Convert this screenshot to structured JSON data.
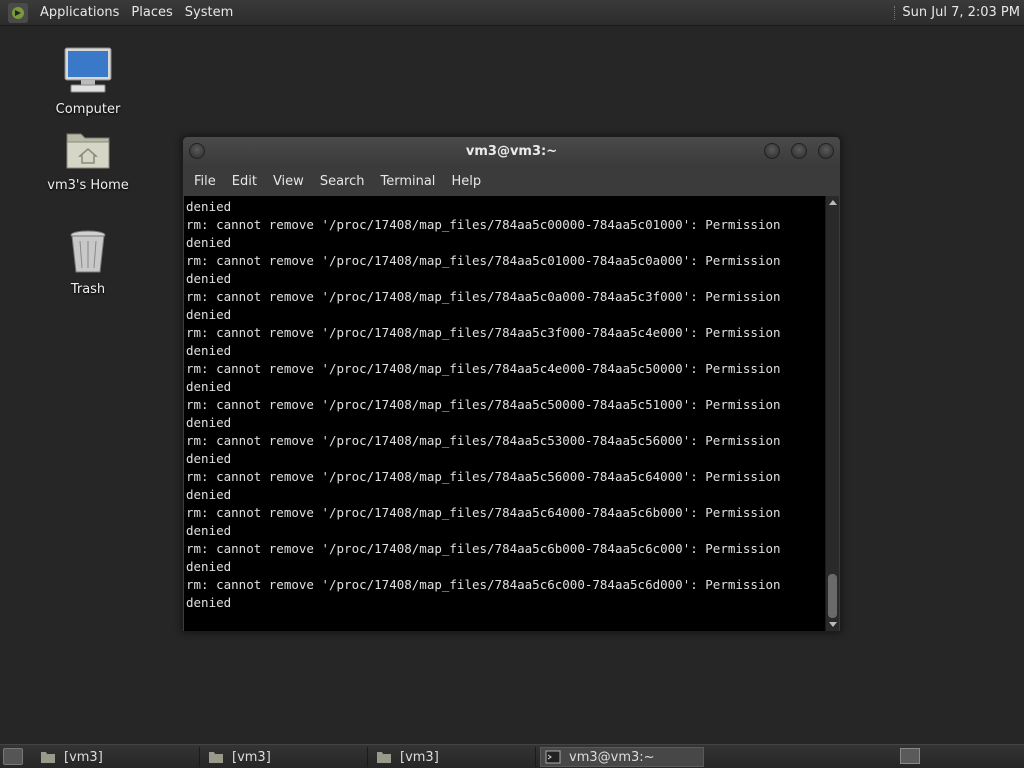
{
  "top_panel": {
    "menus": [
      "Applications",
      "Places",
      "System"
    ],
    "clock": "Sun Jul 7,  2:03 PM"
  },
  "desktop": {
    "icons": [
      {
        "label": "Computer",
        "icon": "computer-icon"
      },
      {
        "label": "vm3's Home",
        "icon": "home-folder-icon"
      },
      {
        "label": "Trash",
        "icon": "trash-icon"
      }
    ]
  },
  "terminal": {
    "title": "vm3@vm3:~",
    "menu": [
      "File",
      "Edit",
      "View",
      "Search",
      "Terminal",
      "Help"
    ],
    "lines": [
      "denied",
      "rm: cannot remove '/proc/17408/map_files/784aa5c00000-784aa5c01000': Permission",
      "denied",
      "rm: cannot remove '/proc/17408/map_files/784aa5c01000-784aa5c0a000': Permission",
      "denied",
      "rm: cannot remove '/proc/17408/map_files/784aa5c0a000-784aa5c3f000': Permission",
      "denied",
      "rm: cannot remove '/proc/17408/map_files/784aa5c3f000-784aa5c4e000': Permission",
      "denied",
      "rm: cannot remove '/proc/17408/map_files/784aa5c4e000-784aa5c50000': Permission",
      "denied",
      "rm: cannot remove '/proc/17408/map_files/784aa5c50000-784aa5c51000': Permission",
      "denied",
      "rm: cannot remove '/proc/17408/map_files/784aa5c53000-784aa5c56000': Permission",
      "denied",
      "rm: cannot remove '/proc/17408/map_files/784aa5c56000-784aa5c64000': Permission",
      "denied",
      "rm: cannot remove '/proc/17408/map_files/784aa5c64000-784aa5c6b000': Permission",
      "denied",
      "rm: cannot remove '/proc/17408/map_files/784aa5c6b000-784aa5c6c000': Permission",
      "denied",
      "rm: cannot remove '/proc/17408/map_files/784aa5c6c000-784aa5c6d000': Permission",
      "denied"
    ]
  },
  "taskbar": {
    "tasks": [
      {
        "label": "[vm3]",
        "icon": "folder-icon"
      },
      {
        "label": "[vm3]",
        "icon": "folder-icon"
      },
      {
        "label": "[vm3]",
        "icon": "folder-icon"
      },
      {
        "label": "vm3@vm3:~",
        "icon": "terminal-icon"
      }
    ]
  }
}
